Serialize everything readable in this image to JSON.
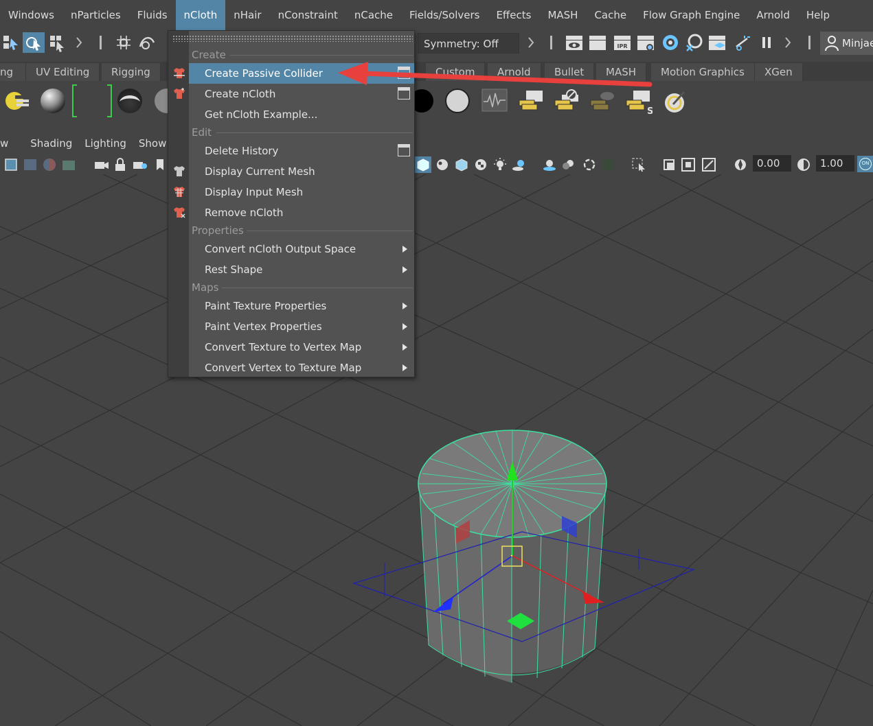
{
  "menubar": {
    "items": [
      "Windows",
      "nParticles",
      "Fluids",
      "nCloth",
      "nHair",
      "nConstraint",
      "nCache",
      "Fields/Solvers",
      "Effects",
      "MASH",
      "Cache",
      "Flow Graph Engine",
      "Arnold",
      "Help"
    ],
    "active": "nCloth"
  },
  "statusline": {
    "symmetry": "Symmetry: Off",
    "user": "Minjae"
  },
  "shelf_tabs": [
    "ng",
    "UV Editing",
    "Rigging",
    "Custom",
    "Arnold",
    "Bullet",
    "MASH",
    "Motion Graphics",
    "XGen"
  ],
  "viewport_menu": [
    "w",
    "Shading",
    "Lighting",
    "Show"
  ],
  "viewport_toolbar": {
    "value_a": "0.00",
    "value_b": "1.00",
    "toggle_label": "ON"
  },
  "ncloth_menu": {
    "sections": {
      "create": "Create",
      "edit": "Edit",
      "properties": "Properties",
      "maps": "Maps"
    },
    "items": {
      "create_passive_collider": "Create Passive Collider",
      "create_ncloth": "Create nCloth",
      "get_example": "Get nCloth Example...",
      "delete_history": "Delete History",
      "display_current_mesh": "Display Current Mesh",
      "display_input_mesh": "Display Input Mesh",
      "remove_ncloth": "Remove nCloth",
      "convert_output_space": "Convert nCloth Output Space",
      "rest_shape": "Rest Shape",
      "paint_texture_props": "Paint Texture Properties",
      "paint_vertex_props": "Paint Vertex Properties",
      "convert_tex_to_vertex": "Convert Texture to Vertex Map",
      "convert_vertex_to_tex": "Convert Vertex to Texture Map"
    }
  },
  "colors": {
    "highlight": "#5285a6",
    "annotation_arrow": "#e8403c",
    "wireframe": "#40e0a0",
    "background": "#444444"
  }
}
